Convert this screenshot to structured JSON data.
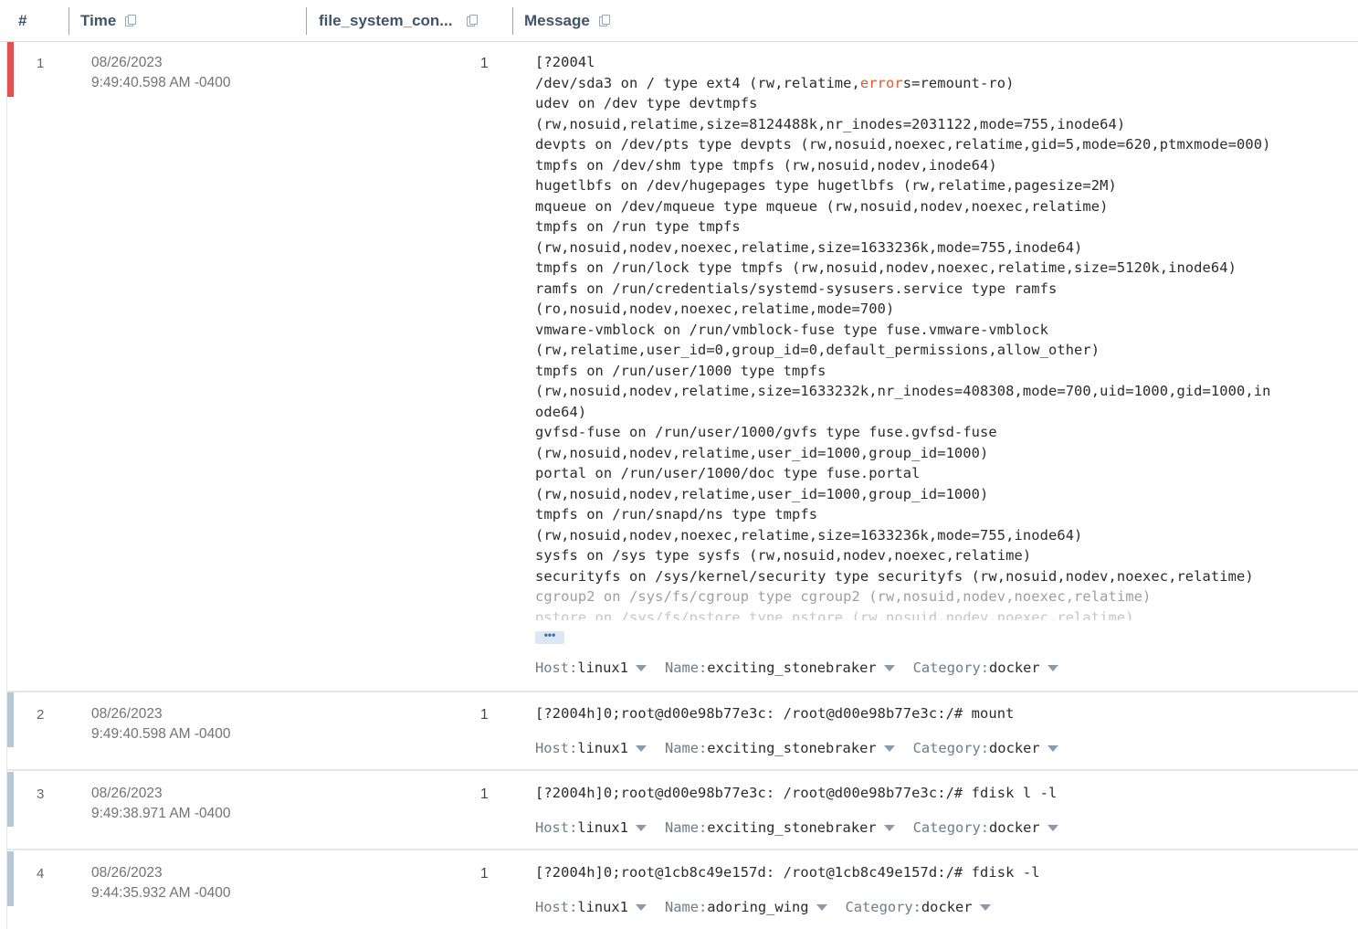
{
  "header": {
    "col_index": "#",
    "col_time": "Time",
    "col_fs": "file_system_con...",
    "col_message": "Message"
  },
  "rows": [
    {
      "index": "1",
      "date": "08/26/2023",
      "time": "9:49:40.598 AM -0400",
      "fs": "1",
      "status": "error",
      "message_lines": [
        "[?2004l",
        "/dev/sda3 on / type ext4 (rw,relatime,errors=remount-ro)",
        "udev on /dev type devtmpfs",
        "(rw,nosuid,relatime,size=8124488k,nr_inodes=2031122,mode=755,inode64)",
        "devpts on /dev/pts type devpts (rw,nosuid,noexec,relatime,gid=5,mode=620,ptmxmode=000)",
        "tmpfs on /dev/shm type tmpfs (rw,nosuid,nodev,inode64)",
        "hugetlbfs on /dev/hugepages type hugetlbfs (rw,relatime,pagesize=2M)",
        "mqueue on /dev/mqueue type mqueue (rw,nosuid,nodev,noexec,relatime)",
        "tmpfs on /run type tmpfs",
        "(rw,nosuid,nodev,noexec,relatime,size=1633236k,mode=755,inode64)",
        "tmpfs on /run/lock type tmpfs (rw,nosuid,nodev,noexec,relatime,size=5120k,inode64)",
        "ramfs on /run/credentials/systemd-sysusers.service type ramfs",
        "(ro,nosuid,nodev,noexec,relatime,mode=700)",
        "vmware-vmblock on /run/vmblock-fuse type fuse.vmware-vmblock",
        "(rw,relatime,user_id=0,group_id=0,default_permissions,allow_other)",
        "tmpfs on /run/user/1000 type tmpfs",
        "(rw,nosuid,nodev,relatime,size=1633232k,nr_inodes=408308,mode=700,uid=1000,gid=1000,in",
        "ode64)",
        "gvfsd-fuse on /run/user/1000/gvfs type fuse.gvfsd-fuse",
        "(rw,nosuid,nodev,relatime,user_id=1000,group_id=1000)",
        "portal on /run/user/1000/doc type fuse.portal",
        "(rw,nosuid,nodev,relatime,user_id=1000,group_id=1000)",
        "tmpfs on /run/snapd/ns type tmpfs",
        "(rw,nosuid,nodev,noexec,relatime,size=1633236k,mode=755,inode64)",
        "sysfs on /sys type sysfs (rw,nosuid,nodev,noexec,relatime)",
        "securityfs on /sys/kernel/security type securityfs (rw,nosuid,nodev,noexec,relatime)",
        "cgroup2 on /sys/fs/cgroup type cgroup2 (rw,nosuid,nodev,noexec,relatime)",
        "pstore on /sys/fs/pstore type pstore (rw,nosuid,nodev,noexec,relatime)"
      ],
      "line2_pre": "/dev/sda3 on / type ext4 (rw,relatime,",
      "line2_hl": "error",
      "line2_post": "s=remount-ro)",
      "more_label": "•••",
      "host_key": "Host:",
      "host_val": "linux1",
      "name_key": "Name:",
      "name_val": "exciting_stonebraker",
      "cat_key": "Category:",
      "cat_val": "docker"
    },
    {
      "index": "2",
      "date": "08/26/2023",
      "time": "9:49:40.598 AM -0400",
      "fs": "1",
      "status": "normal",
      "message": "[?2004h]0;root@d00e98b77e3c: /root@d00e98b77e3c:/# mount",
      "host_key": "Host:",
      "host_val": "linux1",
      "name_key": "Name:",
      "name_val": "exciting_stonebraker",
      "cat_key": "Category:",
      "cat_val": "docker"
    },
    {
      "index": "3",
      "date": "08/26/2023",
      "time": "9:49:38.971 AM -0400",
      "fs": "1",
      "status": "normal",
      "message": "[?2004h]0;root@d00e98b77e3c: /root@d00e98b77e3c:/# fdisk l -l",
      "host_key": "Host:",
      "host_val": "linux1",
      "name_key": "Name:",
      "name_val": "exciting_stonebraker",
      "cat_key": "Category:",
      "cat_val": "docker"
    },
    {
      "index": "4",
      "date": "08/26/2023",
      "time": "9:44:35.932 AM -0400",
      "fs": "1",
      "status": "normal",
      "message": "[?2004h]0;root@1cb8c49e157d: /root@1cb8c49e157d:/# fdisk -l",
      "host_key": "Host:",
      "host_val": "linux1",
      "name_key": "Name:",
      "name_val": "adoring_wing",
      "cat_key": "Category:",
      "cat_val": "docker"
    }
  ],
  "colors": {
    "error_bar": "#e05252",
    "normal_bar": "#b8c7d6",
    "highlight": "#e4582b"
  }
}
